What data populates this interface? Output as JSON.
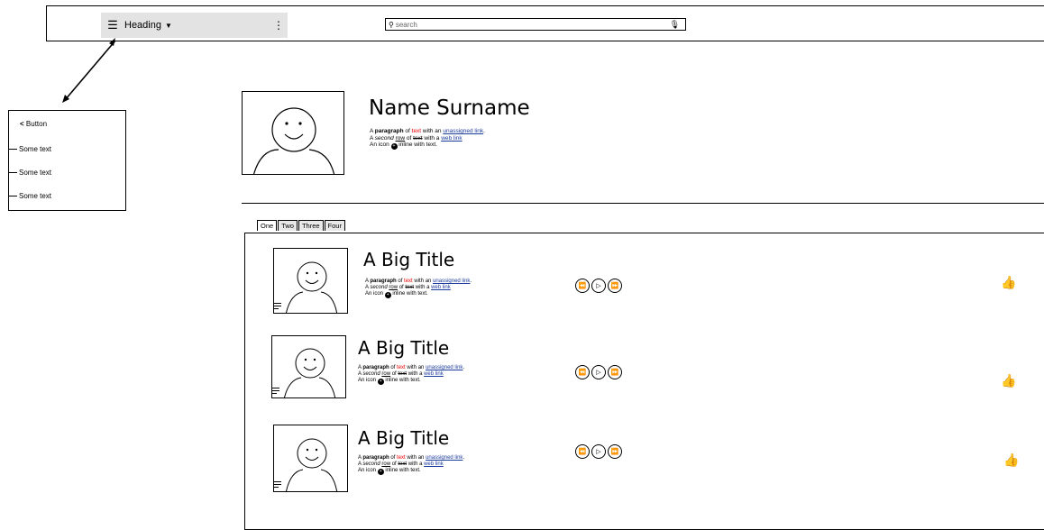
{
  "topbar": {
    "heading_label": "Heading",
    "search_placeholder": "search"
  },
  "side_panel": {
    "button_label": "Button",
    "items": [
      "Some text",
      "Some text",
      "Some text"
    ]
  },
  "profile": {
    "name": "Name Surname",
    "line1_a": "A ",
    "line1_bold": "paragraph",
    "line1_b": " of ",
    "line1_red": "text",
    "line1_c": " with an ",
    "line1_link": "unassigned link",
    "line1_d": ".",
    "line2_a": "A ",
    "line2_italic": "second",
    "line2_b": " ",
    "line2_underline": "row",
    "line2_c": " of ",
    "line2_strike": "text",
    "line2_d": " with a ",
    "line2_link": "web link",
    "line3_a": "An icon ",
    "line3_b": " inline with text."
  },
  "tabs": [
    "One",
    "Two",
    "Three",
    "Four"
  ],
  "items": [
    {
      "title": "A Big Title"
    },
    {
      "title": "A Big Title"
    },
    {
      "title": "A Big Title"
    }
  ]
}
